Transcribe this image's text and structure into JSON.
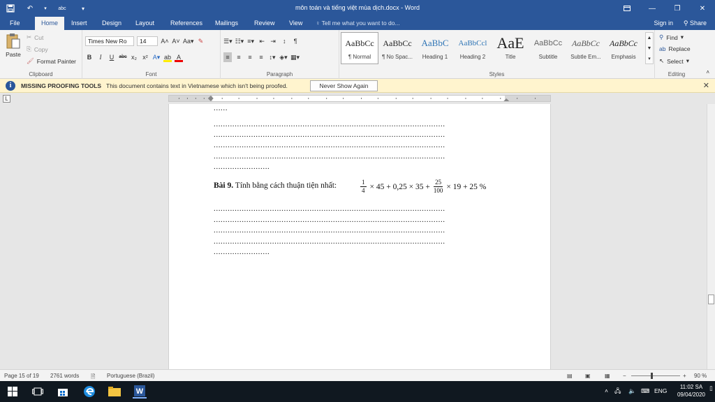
{
  "titlebar": {
    "doc_title": "môn toán và tiếng việt mùa dịch.docx - Word",
    "qat_custom": "abc"
  },
  "tabs": [
    "File",
    "Home",
    "Insert",
    "Design",
    "Layout",
    "References",
    "Mailings",
    "Review",
    "View"
  ],
  "tell_me": "Tell me what you want to do...",
  "signin": "Sign in",
  "share": "Share",
  "ribbon": {
    "clipboard": {
      "label": "Clipboard",
      "paste": "Paste",
      "cut": "Cut",
      "copy": "Copy",
      "format_painter": "Format Painter"
    },
    "font": {
      "label": "Font",
      "font_name": "Times New Ro",
      "font_size": "14"
    },
    "paragraph": {
      "label": "Paragraph"
    },
    "styles": {
      "label": "Styles",
      "items": [
        {
          "sample": "AaBbCc",
          "name": "¶ Normal"
        },
        {
          "sample": "AaBbCc",
          "name": "¶ No Spac..."
        },
        {
          "sample": "AaBbC",
          "name": "Heading 1"
        },
        {
          "sample": "AaBbCcl",
          "name": "Heading 2"
        },
        {
          "sample": "AaE",
          "name": "Title"
        },
        {
          "sample": "AaBbCc",
          "name": "Subtitle"
        },
        {
          "sample": "AaBbCc",
          "name": "Subtle Em..."
        },
        {
          "sample": "AaBbCc",
          "name": "Emphasis"
        }
      ]
    },
    "editing": {
      "label": "Editing",
      "find": "Find",
      "replace": "Replace",
      "select": "Select"
    }
  },
  "message_bar": {
    "title": "MISSING PROOFING TOOLS",
    "text": "This document contains text in Vietnamese which isn't being proofed.",
    "button": "Never Show Again"
  },
  "document": {
    "dots_short": "......",
    "dots_long": "...................................................................................................",
    "dots_tail": "........................",
    "problem_label": "Bài 9.",
    "problem_text": "Tính bằng cách thuận tiện nhất:",
    "math": {
      "frac1_num": "1",
      "frac1_den": "4",
      "part1": "× 45 + 0,25 × 35 +",
      "frac2_num": "25",
      "frac2_den": "100",
      "part2": "× 19 + 25 %"
    }
  },
  "status": {
    "page": "Page 15 of 19",
    "words": "2761 words",
    "language": "Portuguese (Brazil)",
    "zoom": "90 %"
  },
  "taskbar": {
    "lang": "ENG",
    "time": "11:02 SA",
    "date": "09/04/2020"
  },
  "colors": {
    "word_blue": "#2b579a",
    "message_yellow": "#fff4ce"
  }
}
